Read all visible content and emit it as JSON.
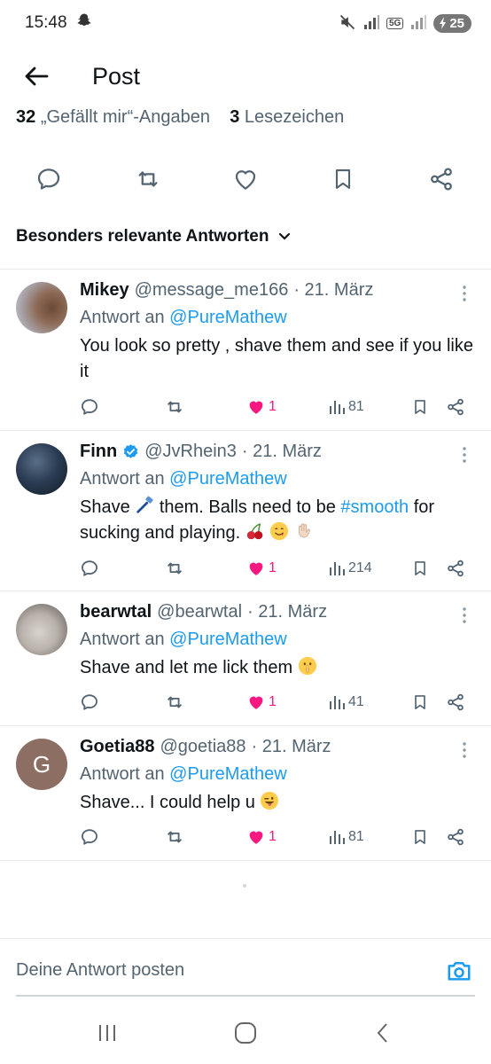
{
  "status_bar": {
    "time": "15:48",
    "battery": "25",
    "network": "5G"
  },
  "header": {
    "title": "Post"
  },
  "stats": {
    "likes_count": "32",
    "likes_label": "„Gefällt mir“-Angaben",
    "bookmarks_count": "3",
    "bookmarks_label": "Lesezeichen"
  },
  "sort": {
    "label": "Besonders relevante Antworten"
  },
  "replies": [
    {
      "name": "Mikey",
      "handle": "@message_me166",
      "date": "· 21. März",
      "reply_to_prefix": "Antwort an",
      "reply_to": "@PureMathew",
      "text": "You look so pretty , shave them and see if you like it",
      "likes": "1",
      "views": "81",
      "verified": false
    },
    {
      "name": "Finn",
      "handle": "@JvRhein3",
      "date": "· 21. März",
      "reply_to_prefix": "Antwort an",
      "reply_to": "@PureMathew",
      "text_a": "Shave",
      "text_b": "them. Balls need to be",
      "hashtag": "#smooth",
      "text_c": "for sucking and playing.",
      "likes": "1",
      "views": "214",
      "verified": true
    },
    {
      "name": "bearwtal",
      "handle": "@bearwtal",
      "date": "· 21. März",
      "reply_to_prefix": "Antwort an",
      "reply_to": "@PureMathew",
      "text": "Shave and let me lick them",
      "likes": "1",
      "views": "41",
      "verified": false
    },
    {
      "name": "Goetia88",
      "handle": "@goetia88",
      "date": "· 21. März",
      "reply_to_prefix": "Antwort an",
      "reply_to": "@PureMathew",
      "text": "Shave... I could help u",
      "likes": "1",
      "views": "81",
      "verified": false,
      "avatar_letter": "G"
    }
  ],
  "compose": {
    "placeholder": "Deine Antwort posten"
  },
  "colors": {
    "accent": "#1d9bf0",
    "like": "#f91880",
    "secondary_text": "#536471",
    "avatar_goetia": "#8d6e63"
  },
  "icons": [
    "back-arrow-icon",
    "reply-icon",
    "retweet-icon",
    "heart-icon",
    "bookmark-icon",
    "share-icon",
    "chevron-down-icon",
    "more-vertical-icon",
    "views-icon",
    "camera-icon",
    "verified-badge-icon"
  ]
}
